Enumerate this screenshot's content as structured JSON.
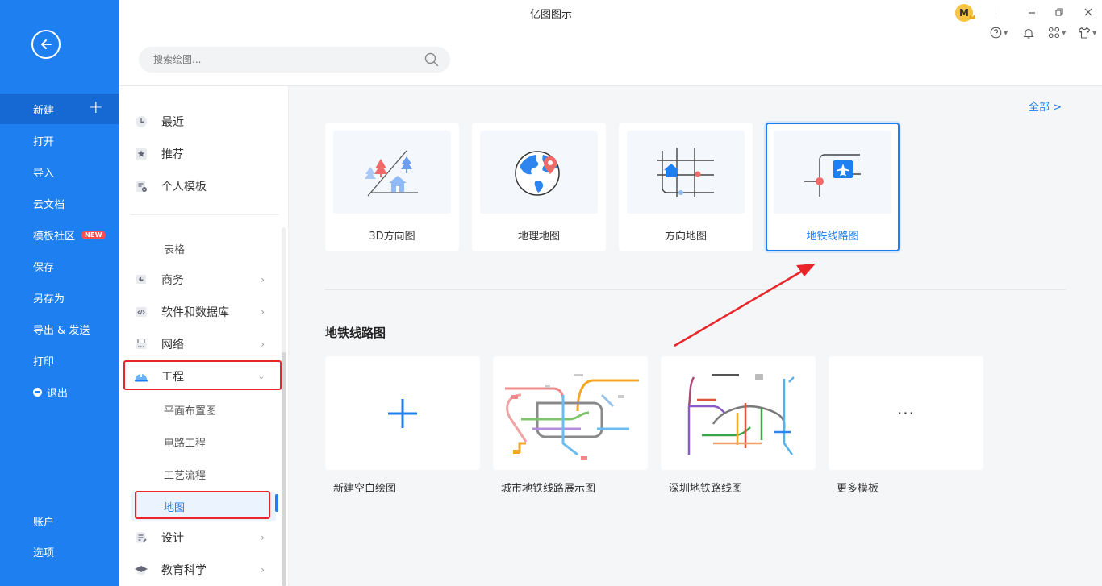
{
  "app": {
    "title": "亿图图示"
  },
  "header": {
    "search_placeholder": "搜索绘图...",
    "avatar_letter": "M"
  },
  "sidebar": {
    "items": [
      {
        "label": "新建",
        "active": true,
        "plus": "+"
      },
      {
        "label": "打开"
      },
      {
        "label": "导入"
      },
      {
        "label": "云文档"
      },
      {
        "label": "模板社区",
        "badge": "NEW"
      },
      {
        "label": "保存"
      },
      {
        "label": "另存为"
      },
      {
        "label": "导出 & 发送"
      },
      {
        "label": "打印"
      },
      {
        "label": "退出"
      }
    ],
    "bottom": [
      {
        "label": "账户"
      },
      {
        "label": "选项"
      }
    ]
  },
  "categories": {
    "top": [
      {
        "label": "最近",
        "icon": "clock-icon"
      },
      {
        "label": "推荐",
        "icon": "star-icon"
      },
      {
        "label": "个人模板",
        "icon": "personal-template-icon"
      }
    ],
    "table_label": "表格",
    "items": [
      {
        "label": "商务",
        "icon": "business-icon"
      },
      {
        "label": "软件和数据库",
        "icon": "code-icon"
      },
      {
        "label": "网络",
        "icon": "network-icon"
      },
      {
        "label": "工程",
        "icon": "engineering-helmet-icon",
        "expanded": true
      }
    ],
    "engineering_sub": [
      {
        "label": "平面布置图"
      },
      {
        "label": "电路工程"
      },
      {
        "label": "工艺流程"
      },
      {
        "label": "地图",
        "selected": true
      }
    ],
    "items_after": [
      {
        "label": "设计",
        "icon": "design-icon"
      },
      {
        "label": "教育科学",
        "icon": "education-icon"
      }
    ]
  },
  "main": {
    "all_link": "全部  >",
    "templates": [
      {
        "label": "3D方向图",
        "icon": "3d-direction-map-icon"
      },
      {
        "label": "地理地图",
        "icon": "globe-icon"
      },
      {
        "label": "方向地图",
        "icon": "direction-map-icon"
      },
      {
        "label": "地铁线路图",
        "icon": "subway-map-icon",
        "active": true
      }
    ],
    "section_title": "地铁线路图",
    "gallery": [
      {
        "label": "新建空白绘图",
        "icon": "plus-icon"
      },
      {
        "label": "城市地铁线路展示图"
      },
      {
        "label": "深圳地铁路线图"
      },
      {
        "label": "更多模板",
        "icon": "more-icon",
        "more": "···"
      }
    ]
  },
  "colors": {
    "sidebar_blue": "#1e7ff0",
    "accent": "#1e7ff0",
    "annotation_red": "#e8262a",
    "badge_red": "#ff4d4f"
  }
}
